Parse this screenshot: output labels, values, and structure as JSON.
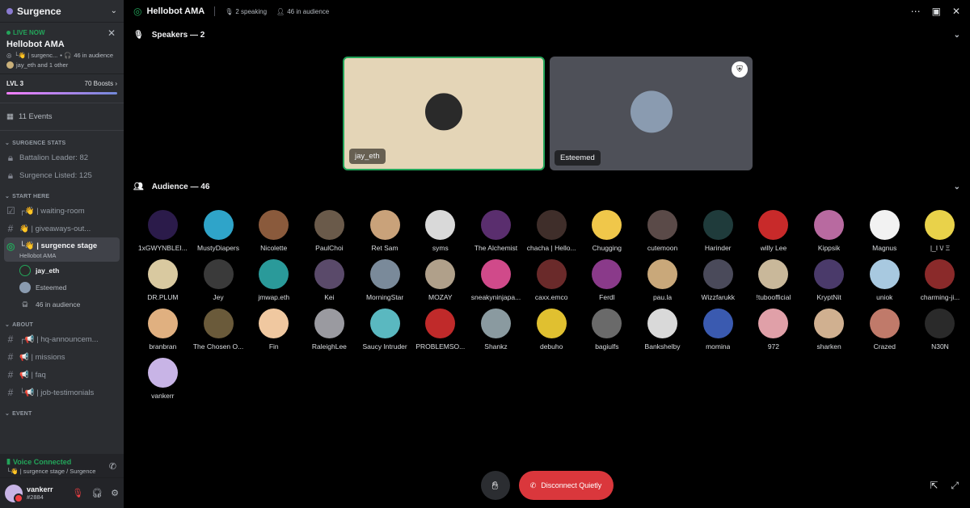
{
  "server": {
    "name": "Surgence"
  },
  "live": {
    "label": "LIVE NOW",
    "title": "Hellobot AMA",
    "channel": "└👋 | surgenc...",
    "audience": "46 in audience",
    "speakers": "jay_eth and 1 other"
  },
  "boost": {
    "level": "LVL 3",
    "boosts": "70 Boosts"
  },
  "events": {
    "label": "11 Events"
  },
  "categories": [
    {
      "name": "SURGENCE STATS",
      "channels": [
        "Battalion Leader: 82",
        "Surgence Listed: 125"
      ]
    },
    {
      "name": "START HERE",
      "channels": [
        "┌👋 | waiting-room",
        "👋 | giveaways-out...",
        "└👋 | surgence stage"
      ]
    },
    {
      "name": "ABOUT",
      "channels": [
        "┌📢 | hq-announcem...",
        "📢 | missions",
        "📢 | faq",
        "└📢 | job-testimonials"
      ]
    },
    {
      "name": "EVENT",
      "channels": []
    }
  ],
  "active_channel_sub": "Hellobot AMA",
  "stage_members": [
    "jay_eth",
    "Esteemed",
    "46 in audience"
  ],
  "voice": {
    "status": "Voice Connected",
    "location": "└👋 | surgence stage / Surgence"
  },
  "user": {
    "name": "vankerr",
    "disc": "#2884"
  },
  "topbar": {
    "title": "Hellobot AMA",
    "speaking": "2 speaking",
    "audience": "46 in audience"
  },
  "speakers_head": "Speakers — 2",
  "audience_head": "Audience — 46",
  "speakers": [
    {
      "name": "jay_eth",
      "color": "#2a2a2a"
    },
    {
      "name": "Esteemed",
      "color": "#8a9bb0"
    }
  ],
  "audience": [
    {
      "name": "1xGWYNBLEI...",
      "color": "#2b1b4a"
    },
    {
      "name": "MustyDiapers",
      "color": "#2fa4c9"
    },
    {
      "name": "Nicolette",
      "color": "#8a5a3c"
    },
    {
      "name": "PaulChoi",
      "color": "#6a5a4a"
    },
    {
      "name": "Ret Sam",
      "color": "#c9a27a"
    },
    {
      "name": "syms",
      "color": "#d9d9d9"
    },
    {
      "name": "The Alchemist",
      "color": "#5a2e6e"
    },
    {
      "name": "chacha | Hello...",
      "color": "#3f2e2a"
    },
    {
      "name": "Chugging",
      "color": "#f0c74a"
    },
    {
      "name": "cutemoon",
      "color": "#5a4a48"
    },
    {
      "name": "Harinder",
      "color": "#1f3b3b"
    },
    {
      "name": "willy Lee",
      "color": "#c82a2a"
    },
    {
      "name": "Kippsik",
      "color": "#b86aa0"
    },
    {
      "name": "Magnus",
      "color": "#f2f2f2"
    },
    {
      "name": "|_I \\/ Ξ",
      "color": "#e9d24a"
    },
    {
      "name": "DR.PLUM",
      "color": "#d9c9a0"
    },
    {
      "name": "Jey",
      "color": "#3a3a3a"
    },
    {
      "name": "jmwap.eth",
      "color": "#2a9a9a"
    },
    {
      "name": "Kei",
      "color": "#5a4a6a"
    },
    {
      "name": "MorningStar",
      "color": "#7a8a9a"
    },
    {
      "name": "MOZAY",
      "color": "#b0a08a"
    },
    {
      "name": "sneakyninjapa...",
      "color": "#d04a8a"
    },
    {
      "name": "caxx.emco",
      "color": "#6a2a2a"
    },
    {
      "name": "Ferdl",
      "color": "#8a3a8a"
    },
    {
      "name": "pau.la",
      "color": "#c9a87a"
    },
    {
      "name": "Wizzfarukk",
      "color": "#4a4a5a"
    },
    {
      "name": "!tuboofficial",
      "color": "#c9b89a"
    },
    {
      "name": "KryptNit",
      "color": "#4a3a6a"
    },
    {
      "name": "uniok",
      "color": "#a8c9e0"
    },
    {
      "name": "charming-ji...",
      "color": "#8a2a2a"
    },
    {
      "name": "branbran",
      "color": "#e0b080"
    },
    {
      "name": "The Chosen O...",
      "color": "#6a5a3a"
    },
    {
      "name": "Fin",
      "color": "#f0c8a0"
    },
    {
      "name": "RaleighLee",
      "color": "#9a9aa0"
    },
    {
      "name": "Saucy Intruder",
      "color": "#5ab8c0"
    },
    {
      "name": "PROBLEMSO...",
      "color": "#c02a2a"
    },
    {
      "name": "Shankz",
      "color": "#8a9aa0"
    },
    {
      "name": "debuho",
      "color": "#e0c030"
    },
    {
      "name": "bagiulfs",
      "color": "#6a6a6a"
    },
    {
      "name": "Bankshelby",
      "color": "#d9d9d9"
    },
    {
      "name": "momina",
      "color": "#3a5ab0"
    },
    {
      "name": "972",
      "color": "#e0a0a8"
    },
    {
      "name": "sharken",
      "color": "#d0b090"
    },
    {
      "name": "Crazed",
      "color": "#c07a6a"
    },
    {
      "name": "N30N",
      "color": "#2a2a2a"
    },
    {
      "name": "vankerr",
      "color": "#c8b4e6"
    }
  ],
  "controls": {
    "disconnect": "Disconnect Quietly"
  }
}
